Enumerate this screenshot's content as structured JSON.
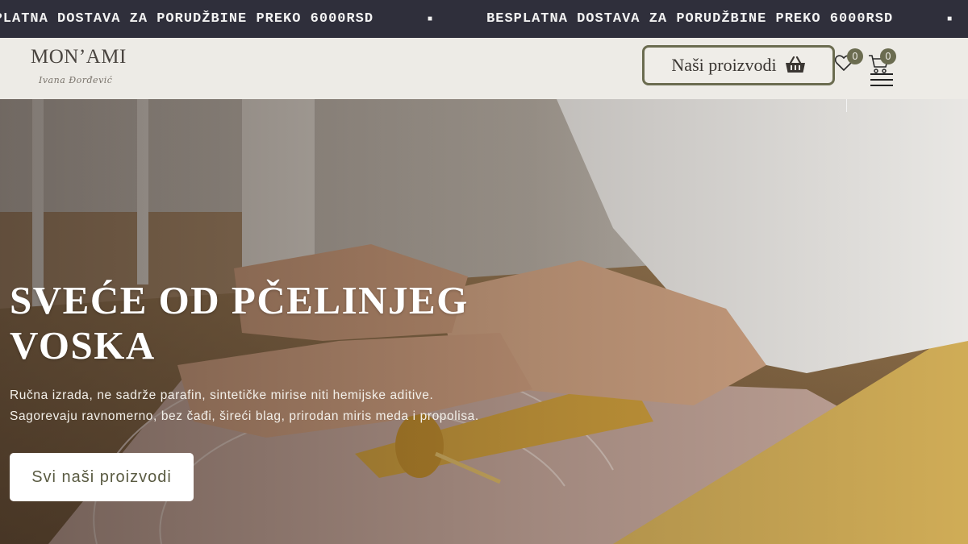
{
  "announcement": {
    "message": "BESPLATNA DOSTAVA ZA PORUDŽBINE PREKO 6000RSD",
    "separator": "■"
  },
  "header": {
    "logo": {
      "brand": "MON’AMI",
      "signature": "Ivana Đorđević"
    },
    "products_button": {
      "label": "Naši proizvodi",
      "icon": "basket-icon"
    },
    "wishlist": {
      "icon": "heart-icon",
      "count": "0"
    },
    "cart": {
      "icon": "cart-icon",
      "count": "0"
    },
    "menu": {
      "icon": "hamburger-menu-icon"
    }
  },
  "hero": {
    "title_line1": "SVEĆE OD PČELINJEG",
    "title_line2": "VOSKA",
    "description_line1": "Ručna izrada, ne sadrže parafin, sintetičke mirise niti hemijske aditive.",
    "description_line2": "Sagorevaju ravnomerno, bez čađi, šireći blag, prirodan miris meda i propolisa.",
    "cta_label": "Svi naši proizvodi"
  },
  "colors": {
    "announcement_bg": "#2f2f3b",
    "header_bg": "#edebe6",
    "accent_olive": "#6b6c50",
    "hero_text": "#ffffff"
  }
}
